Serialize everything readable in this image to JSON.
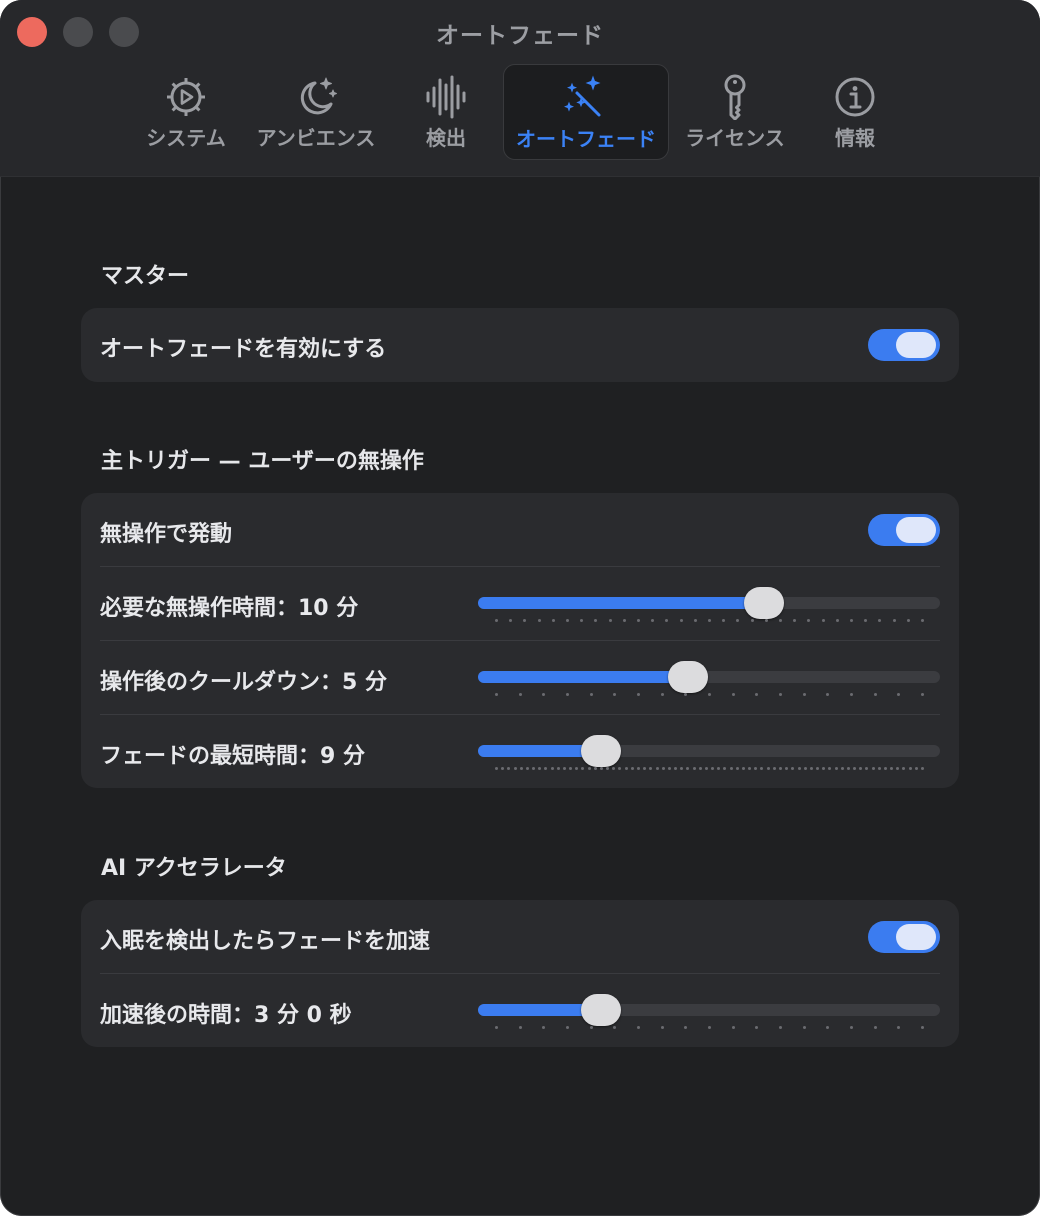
{
  "window": {
    "title": "オートフェード"
  },
  "tabs": [
    {
      "label": "システム",
      "icon": "gear-play-icon",
      "active": false
    },
    {
      "label": "アンビエンス",
      "icon": "moon-stars-icon",
      "active": false
    },
    {
      "label": "検出",
      "icon": "waveform-icon",
      "active": false
    },
    {
      "label": "オートフェード",
      "icon": "magic-wand-icon",
      "active": true
    },
    {
      "label": "ライセンス",
      "icon": "key-icon",
      "active": false
    },
    {
      "label": "情報",
      "icon": "info-icon",
      "active": false
    }
  ],
  "colors": {
    "accent": "#3b7cf0",
    "active_tab_text": "#3b82f6",
    "background": "#1f2022",
    "card": "#2a2b2e"
  },
  "sections": {
    "master": {
      "title": "マスター",
      "enable_autofade": {
        "label": "オートフェードを有効にする",
        "on": true
      }
    },
    "trigger": {
      "title": "主トリガー — ユーザーの無操作",
      "fire_on_idle": {
        "label": "無操作で発動",
        "on": true
      },
      "idle_time": {
        "label": "必要な無操作時間：10 分",
        "fraction": 0.63,
        "ticks": 31
      },
      "cooldown": {
        "label": "操作後のクールダウン：5 分",
        "fraction": 0.45,
        "ticks": 19
      },
      "min_fade": {
        "label": "フェードの最短時間：9 分",
        "fraction": 0.245,
        "ticks": 70
      }
    },
    "ai": {
      "title": "AI アクセラレータ",
      "accelerate": {
        "label": "入眠を検出したらフェードを加速",
        "on": true
      },
      "after_time": {
        "label": "加速後の時間：3 分 0 秒",
        "fraction": 0.245,
        "ticks": 19
      }
    }
  }
}
